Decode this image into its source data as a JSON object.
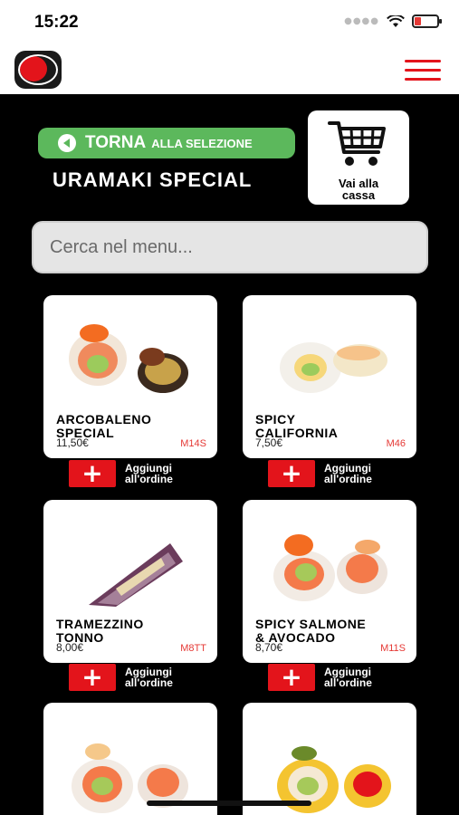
{
  "status": {
    "time": "15:22"
  },
  "header": {
    "logo": "app-logo",
    "menu_icon": "hamburger-icon"
  },
  "nav": {
    "back_main": "TORNA",
    "back_sub": "ALLA SELEZIONE",
    "category": "URAMAKI SPECIAL",
    "cart_label_line1": "Vai alla",
    "cart_label_line2": "cassa"
  },
  "search": {
    "placeholder": "Cerca nel menu..."
  },
  "add_label_line1": "Aggiungi",
  "add_label_line2": "all'ordine",
  "colors": {
    "accent": "#e3141b",
    "green": "#5cb85c"
  },
  "products": [
    {
      "name_line1": "ARCOBALENO",
      "name_line2": "SPECIAL",
      "price": "11,50€",
      "code": "M14S"
    },
    {
      "name_line1": "SPICY",
      "name_line2": "CALIFORNIA",
      "price": "7,50€",
      "code": "M46"
    },
    {
      "name_line1": "TRAMEZZINO",
      "name_line2": "TONNO",
      "price": "8,00€",
      "code": "M8TT"
    },
    {
      "name_line1": "SPICY SALMONE",
      "name_line2": "& AVOCADO",
      "price": "8,70€",
      "code": "M11S"
    },
    {
      "name_line1": "",
      "name_line2": "",
      "price": "",
      "code": ""
    },
    {
      "name_line1": "",
      "name_line2": "",
      "price": "",
      "code": ""
    }
  ]
}
